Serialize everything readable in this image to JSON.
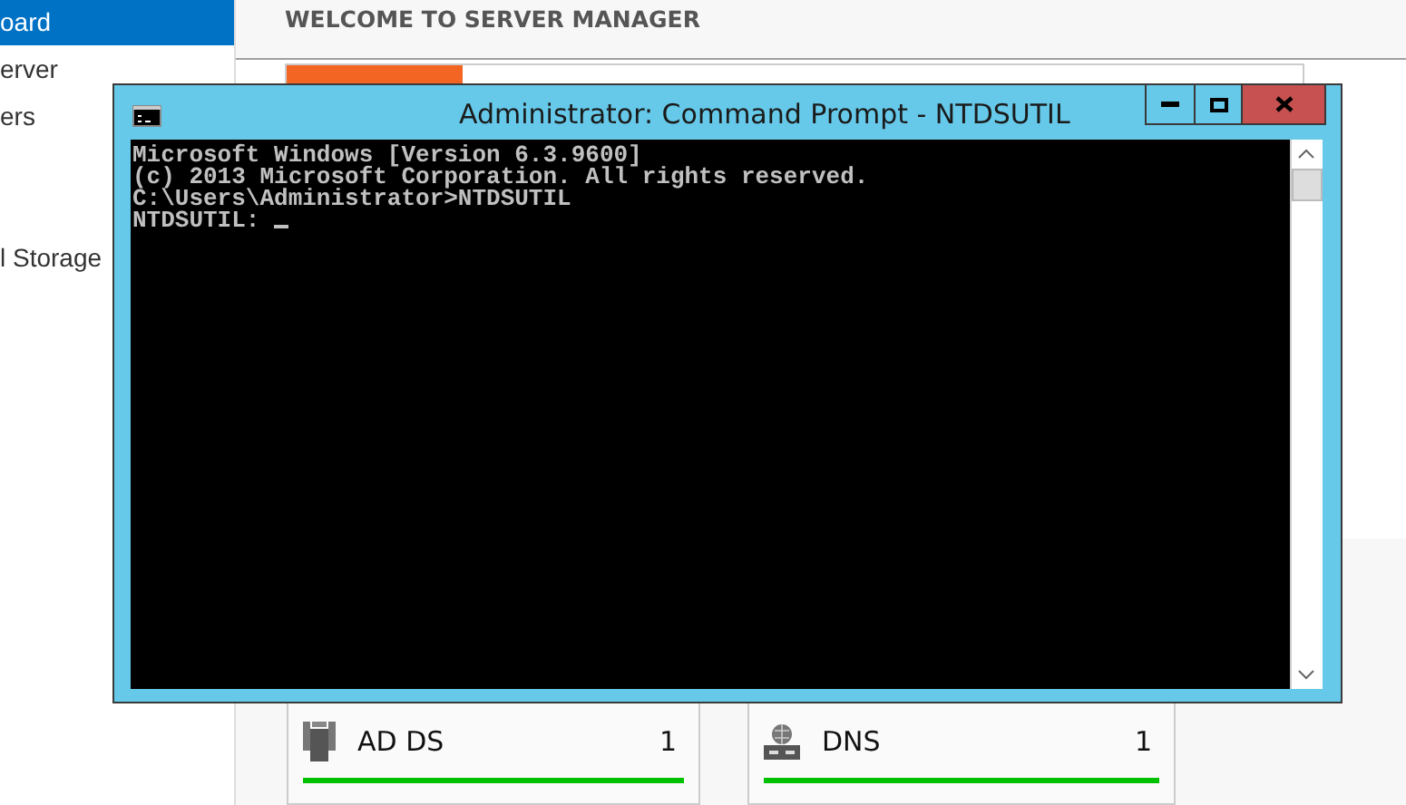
{
  "sidebar": {
    "items": [
      {
        "label": "oard",
        "selected": true
      },
      {
        "label": "erver",
        "selected": false
      },
      {
        "label": "ers",
        "selected": false
      },
      {
        "label": "l Storage",
        "selected": false
      }
    ]
  },
  "main": {
    "title": "WELCOME TO SERVER MANAGER"
  },
  "tiles": [
    {
      "kind": "adds",
      "name": "AD DS",
      "count": "1"
    },
    {
      "kind": "dns",
      "name": "DNS",
      "count": "1"
    }
  ],
  "console_window": {
    "title": "Administrator: Command Prompt - NTDSUTIL",
    "blocks": [
      [
        "Microsoft Windows [Version 6.3.9600]",
        "(c) 2013 Microsoft Corporation. All rights reserved."
      ],
      [
        "C:\\Users\\Administrator>NTDSUTIL"
      ]
    ],
    "prompt": "NTDSUTIL:"
  }
}
